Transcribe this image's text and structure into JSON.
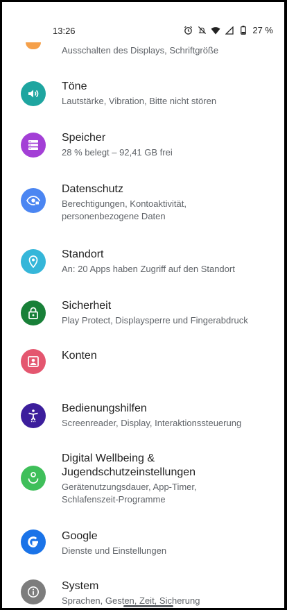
{
  "status_bar": {
    "time": "13:26",
    "battery": "27 %",
    "icons": [
      "alarm-icon",
      "mute-icon",
      "wifi-icon",
      "signal-icon",
      "battery-icon"
    ]
  },
  "settings": {
    "partial_item": {
      "subtitle": "Ausschalten des Displays, Schriftgröße",
      "color": "#f5a04a"
    },
    "items": [
      {
        "title": "Töne",
        "subtitle": "Lautstärke, Vibration, Bitte nicht stören",
        "icon": "volume-icon",
        "color": "#1ea5a0"
      },
      {
        "title": "Speicher",
        "subtitle": "28 % belegt – 92,41 GB frei",
        "icon": "storage-icon",
        "color": "#a33fd6"
      },
      {
        "title": "Datenschutz",
        "subtitle": "Berechtigungen, Kontoaktivität,",
        "subtitle2": "personenbezogene Daten",
        "icon": "privacy-eye-icon",
        "color": "#4b86f2"
      },
      {
        "title": "Standort",
        "subtitle": "An: 20 Apps haben Zugriff auf den Standort",
        "icon": "location-pin-icon",
        "color": "#35b6d9"
      },
      {
        "title": "Sicherheit",
        "subtitle": "Play Protect, Displaysperre und Fingerabdruck",
        "icon": "lock-icon",
        "color": "#188038"
      },
      {
        "title": "Konten",
        "subtitle": "",
        "icon": "account-box-icon",
        "color": "#e4566f"
      },
      {
        "title": "Bedienungshilfen",
        "subtitle": "Screenreader, Display, Interaktionssteuerung",
        "icon": "accessibility-icon",
        "color": "#3c1e9c"
      },
      {
        "title": "Digital Wellbeing &",
        "title2": "Jugendschutzeinstellungen",
        "subtitle": "Gerätenutzungsdauer, App-Timer,",
        "subtitle2": "Schlafenszeit-Programme",
        "icon": "wellbeing-icon",
        "color": "#3fbf5a"
      },
      {
        "title": "Google",
        "subtitle": "Dienste und Einstellungen",
        "icon": "google-icon",
        "color": "#1a73e8"
      },
      {
        "title": "System",
        "subtitle": "Sprachen, Gesten, Zeit, Sicherung",
        "icon": "info-icon",
        "color": "#7d7d7d"
      }
    ]
  }
}
